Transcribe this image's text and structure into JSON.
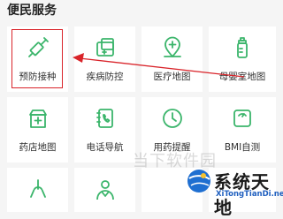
{
  "section": {
    "title": "便民服务"
  },
  "tiles": [
    {
      "label": "预防接种",
      "icon": "syringe-icon"
    },
    {
      "label": "疾病防控",
      "icon": "medical-box-icon"
    },
    {
      "label": "医疗地图",
      "icon": "map-pin-icon"
    },
    {
      "label": "母婴室地图",
      "icon": "baby-bottle-icon"
    },
    {
      "label": "药店地图",
      "icon": "pharmacy-store-icon"
    },
    {
      "label": "电话导航",
      "icon": "phone-book-icon"
    },
    {
      "label": "用药提醒",
      "icon": "clock-icon"
    },
    {
      "label": "BMI自测",
      "icon": "scale-icon"
    },
    {
      "label": "",
      "icon": "lungs-icon"
    },
    {
      "label": "",
      "icon": "doctor-icon"
    }
  ],
  "watermark": {
    "title": "系统天地",
    "subtitle": "XiTongTianDi.net",
    "faint": "当下软件园"
  },
  "colors": {
    "icon": "#3bb56b",
    "annotation": "#d9242a"
  }
}
